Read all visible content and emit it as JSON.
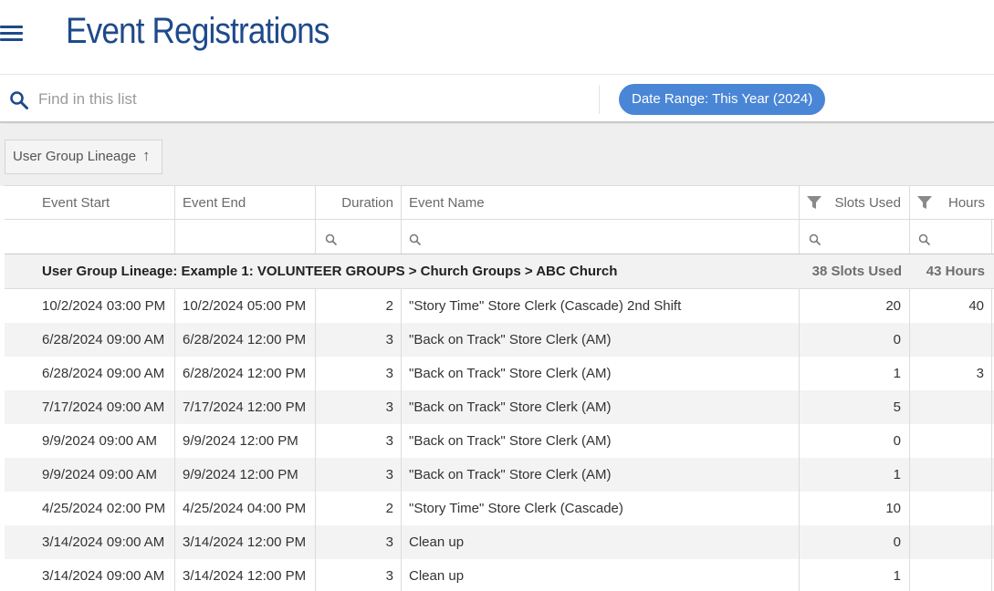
{
  "header": {
    "title": "Event Registrations",
    "menu_icon": "hamburger-menu-icon"
  },
  "search": {
    "placeholder": "Find in this list",
    "value": "",
    "icon": "search-icon"
  },
  "date_filter": {
    "label": "Date Range: This Year (2024)",
    "color": "#4a86d6"
  },
  "grouping": {
    "label": "User Group Lineage",
    "sort_icon": "sort-ascending-arrow-icon"
  },
  "columns": {
    "start": "Event Start",
    "end": "Event End",
    "duration": "Duration",
    "name": "Event Name",
    "slots": "Slots Used",
    "hours": "Hours"
  },
  "group_row": {
    "label": "User Group Lineage: Example 1: VOLUNTEER GROUPS > Church Groups > ABC Church",
    "slots_total": "38 Slots Used",
    "hours_total": "43 Hours"
  },
  "rows": [
    {
      "start": "10/2/2024 03:00 PM",
      "end": "10/2/2024 05:00 PM",
      "duration": "2",
      "name": "\"Story Time\" Store Clerk (Cascade) 2nd Shift",
      "slots": "20",
      "hours": "40"
    },
    {
      "start": "6/28/2024 09:00 AM",
      "end": "6/28/2024 12:00 PM",
      "duration": "3",
      "name": "\"Back on Track\" Store Clerk (AM)",
      "slots": "0",
      "hours": ""
    },
    {
      "start": "6/28/2024 09:00 AM",
      "end": "6/28/2024 12:00 PM",
      "duration": "3",
      "name": "\"Back on Track\" Store Clerk (AM)",
      "slots": "1",
      "hours": "3"
    },
    {
      "start": "7/17/2024 09:00 AM",
      "end": "7/17/2024 12:00 PM",
      "duration": "3",
      "name": "\"Back on Track\" Store Clerk (AM)",
      "slots": "5",
      "hours": ""
    },
    {
      "start": "9/9/2024 09:00 AM",
      "end": "9/9/2024 12:00 PM",
      "duration": "3",
      "name": "\"Back on Track\" Store Clerk (AM)",
      "slots": "0",
      "hours": ""
    },
    {
      "start": "9/9/2024 09:00 AM",
      "end": "9/9/2024 12:00 PM",
      "duration": "3",
      "name": "\"Back on Track\" Store Clerk (AM)",
      "slots": "1",
      "hours": ""
    },
    {
      "start": "4/25/2024 02:00 PM",
      "end": "4/25/2024 04:00 PM",
      "duration": "2",
      "name": "\"Story Time\" Store Clerk (Cascade)",
      "slots": "10",
      "hours": ""
    },
    {
      "start": "3/14/2024 09:00 AM",
      "end": "3/14/2024 12:00 PM",
      "duration": "3",
      "name": "Clean up",
      "slots": "0",
      "hours": ""
    },
    {
      "start": "3/14/2024 09:00 AM",
      "end": "3/14/2024 12:00 PM",
      "duration": "3",
      "name": "Clean up",
      "slots": "1",
      "hours": ""
    }
  ],
  "colors": {
    "brand": "#1e4a8a",
    "chip": "#4a86d6",
    "row_alt": "#f3f3f3"
  }
}
